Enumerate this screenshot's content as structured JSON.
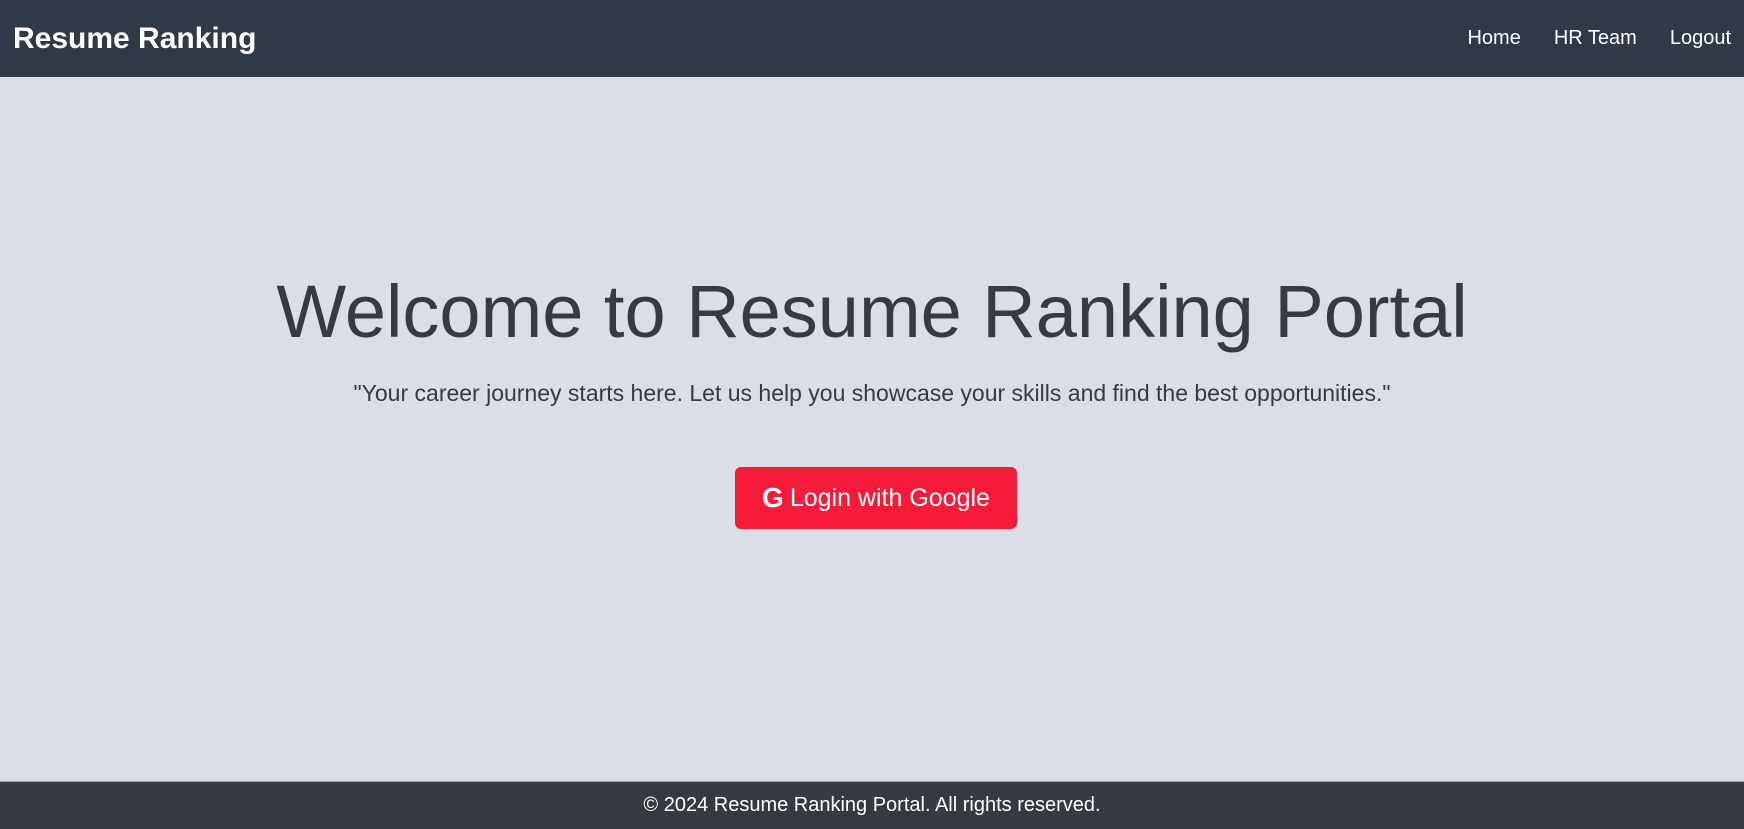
{
  "navbar": {
    "brand": "Resume Ranking",
    "links": [
      {
        "label": "Home"
      },
      {
        "label": "HR Team"
      },
      {
        "label": "Logout"
      }
    ]
  },
  "hero": {
    "title": "Welcome to Resume Ranking Portal",
    "subtitle": "\"Your career journey starts here. Let us help you showcase your skills and find the best opportunities.\"",
    "login_button": {
      "icon": "google-icon",
      "icon_glyph": "G",
      "label": "Login with Google"
    }
  },
  "footer": {
    "text": "© 2024 Resume Ranking Portal. All rights reserved."
  },
  "colors": {
    "navbar": "#2e3a45",
    "background": "#dadee7",
    "button": "#f61c39",
    "footer": "#343a40"
  }
}
